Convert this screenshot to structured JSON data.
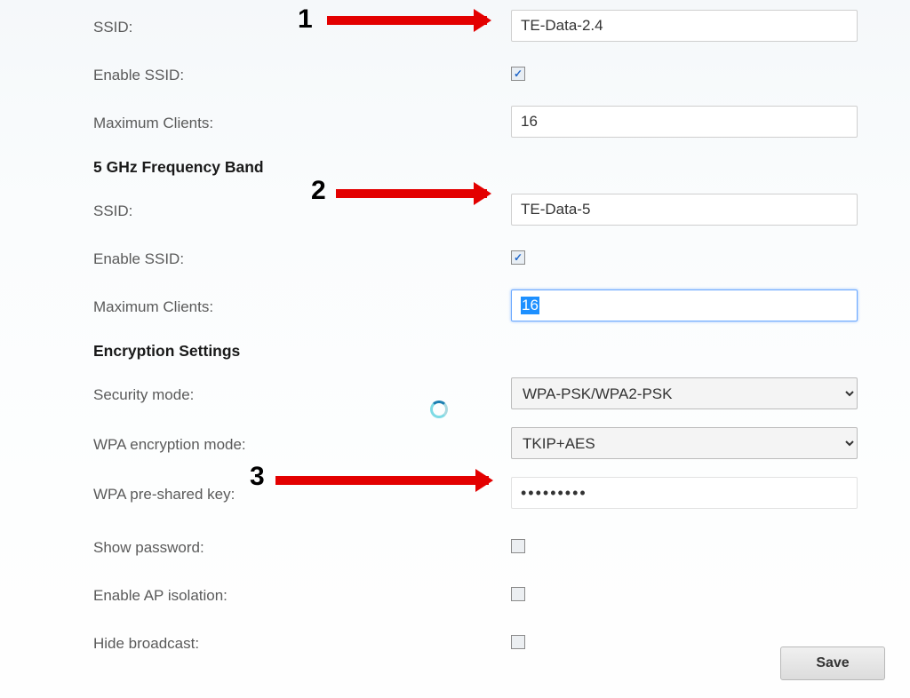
{
  "band24": {
    "ssid_label": "SSID:",
    "ssid_value": "TE-Data-2.4",
    "enable_label": "Enable SSID:",
    "enable_checked": true,
    "max_label": "Maximum Clients:",
    "max_value": "16"
  },
  "band5_header": "5 GHz Frequency Band",
  "band5": {
    "ssid_label": "SSID:",
    "ssid_value": "TE-Data-5",
    "enable_label": "Enable SSID:",
    "enable_checked": true,
    "max_label": "Maximum Clients:",
    "max_value": "16"
  },
  "encryption_header": "Encryption Settings",
  "encryption": {
    "security_label": "Security mode:",
    "security_value": "WPA-PSK/WPA2-PSK",
    "wpa_mode_label": "WPA encryption mode:",
    "wpa_mode_value": "TKIP+AES",
    "psk_label": "WPA pre-shared key:",
    "psk_value": "•••••••••",
    "showpass_label": "Show password:",
    "apiso_label": "Enable AP isolation:",
    "hide_label": "Hide broadcast:"
  },
  "save_label": "Save",
  "annotations": {
    "a1": "1",
    "a2": "2",
    "a3": "3"
  }
}
